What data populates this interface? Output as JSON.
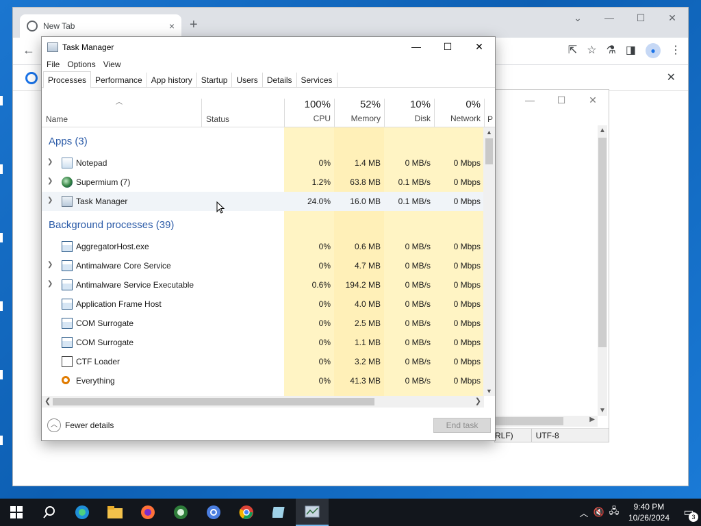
{
  "browser": {
    "tab_title": "New Tab",
    "tab_close": "×",
    "new_tab": "+",
    "back": "←",
    "minimize": "⌄",
    "maximize": "☐",
    "close": "✕",
    "infobar_close": "✕"
  },
  "notepad": {
    "status_eol": "RLF)",
    "status_encoding": "UTF-8"
  },
  "taskmanager": {
    "title": "Task Manager",
    "menu": [
      "File",
      "Options",
      "View"
    ],
    "tabs": [
      "Processes",
      "Performance",
      "App history",
      "Startup",
      "Users",
      "Details",
      "Services"
    ],
    "active_tab": "Processes",
    "columns": {
      "name": "Name",
      "status": "Status",
      "cpu_pct": "100%",
      "cpu": "CPU",
      "memory_pct": "52%",
      "memory": "Memory",
      "disk_pct": "10%",
      "disk": "Disk",
      "network_pct": "0%",
      "network": "Network",
      "next": "P"
    },
    "groups": {
      "apps": "Apps (3)",
      "background": "Background processes (39)"
    },
    "apps": [
      {
        "name": "Notepad",
        "cpu": "0%",
        "memory": "1.4 MB",
        "disk": "0 MB/s",
        "network": "0 Mbps"
      },
      {
        "name": "Supermium (7)",
        "cpu": "1.2%",
        "memory": "63.8 MB",
        "disk": "0.1 MB/s",
        "network": "0 Mbps"
      },
      {
        "name": "Task Manager",
        "cpu": "24.0%",
        "memory": "16.0 MB",
        "disk": "0.1 MB/s",
        "network": "0 Mbps"
      }
    ],
    "background": [
      {
        "name": "AggregatorHost.exe",
        "cpu": "0%",
        "memory": "0.6 MB",
        "disk": "0 MB/s",
        "network": "0 Mbps"
      },
      {
        "name": "Antimalware Core Service",
        "cpu": "0%",
        "memory": "4.7 MB",
        "disk": "0 MB/s",
        "network": "0 Mbps"
      },
      {
        "name": "Antimalware Service Executable",
        "cpu": "0.6%",
        "memory": "194.2 MB",
        "disk": "0 MB/s",
        "network": "0 Mbps"
      },
      {
        "name": "Application Frame Host",
        "cpu": "0%",
        "memory": "4.0 MB",
        "disk": "0 MB/s",
        "network": "0 Mbps"
      },
      {
        "name": "COM Surrogate",
        "cpu": "0%",
        "memory": "2.5 MB",
        "disk": "0 MB/s",
        "network": "0 Mbps"
      },
      {
        "name": "COM Surrogate",
        "cpu": "0%",
        "memory": "1.1 MB",
        "disk": "0 MB/s",
        "network": "0 Mbps"
      },
      {
        "name": "CTF Loader",
        "cpu": "0%",
        "memory": "3.2 MB",
        "disk": "0 MB/s",
        "network": "0 Mbps"
      },
      {
        "name": "Everything",
        "cpu": "0%",
        "memory": "41.3 MB",
        "disk": "0 MB/s",
        "network": "0 Mbps"
      }
    ],
    "fewer_details": "Fewer details",
    "end_task": "End task"
  },
  "taskbar": {
    "time": "9:40 PM",
    "date": "10/26/2024",
    "notifications": "3"
  }
}
